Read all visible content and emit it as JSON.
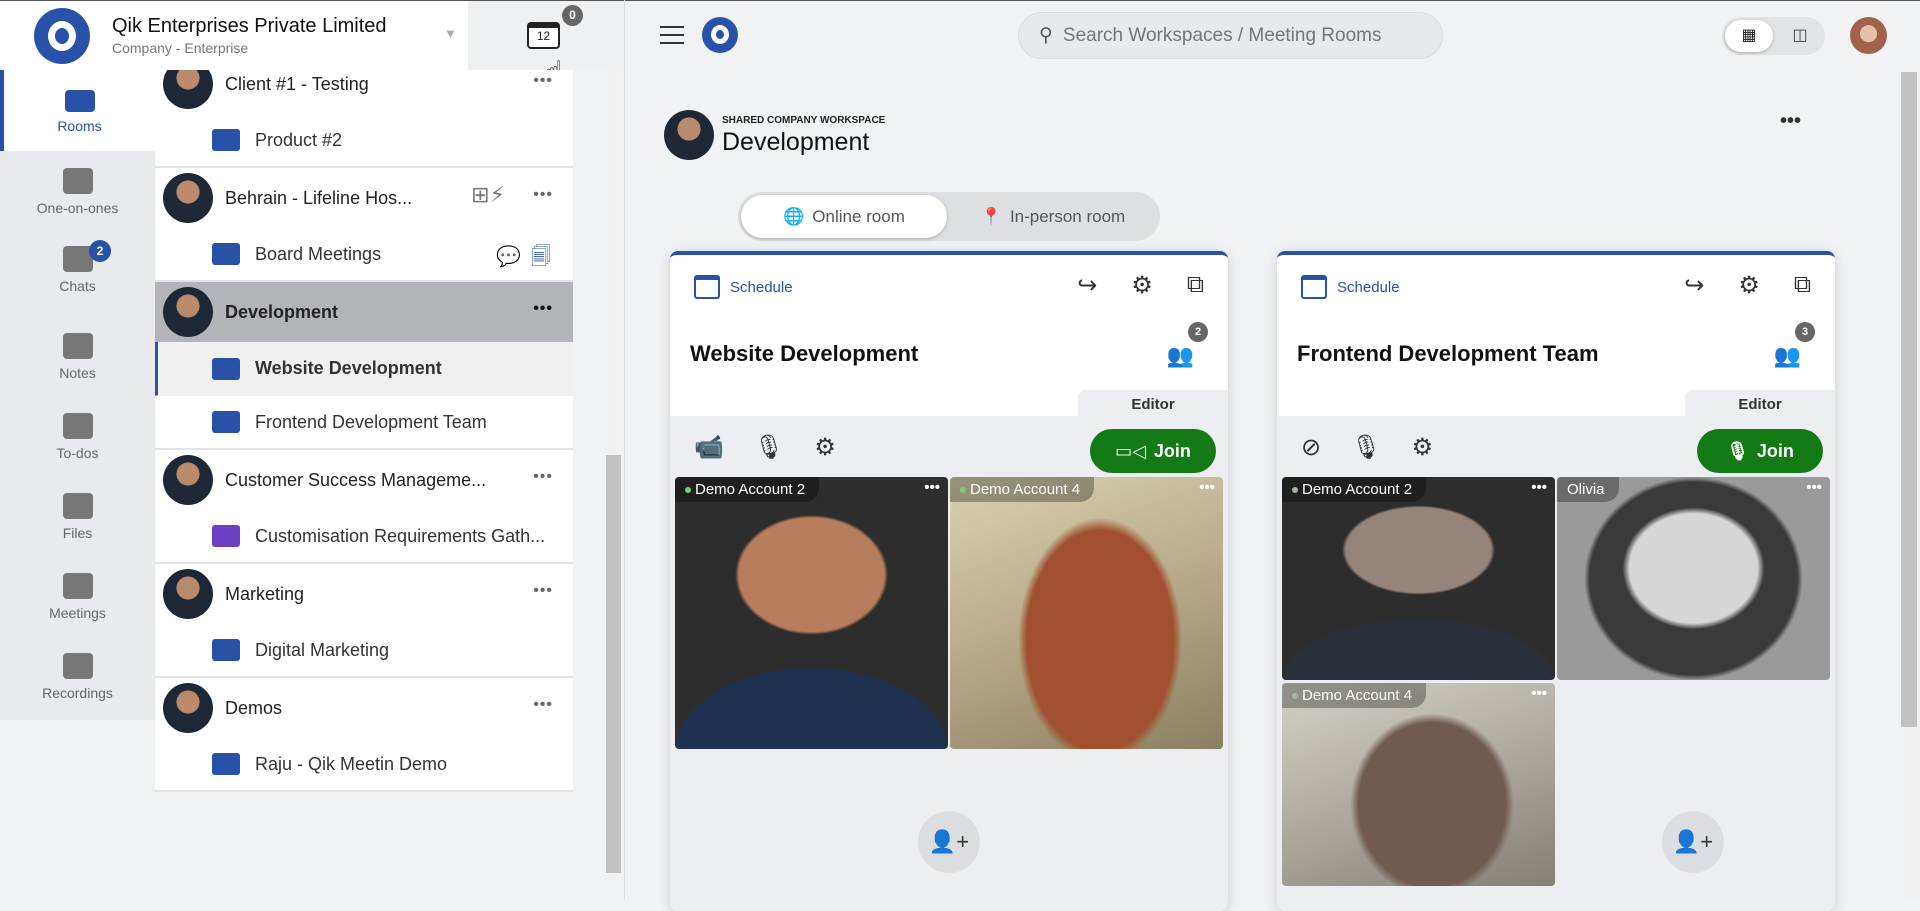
{
  "org": {
    "name": "Qik Enterprises Private Limited",
    "subtitle": "Company - Enterprise",
    "calendar_day": "12",
    "calendar_badge": "0"
  },
  "rail": [
    {
      "label": "Rooms",
      "icon": "rooms-icon",
      "active": true
    },
    {
      "label": "One-on-ones",
      "icon": "people-icon"
    },
    {
      "label": "Chats",
      "icon": "chat-icon",
      "badge": "2"
    },
    {
      "label": "Notes",
      "icon": "notes-icon"
    },
    {
      "label": "To-dos",
      "icon": "todo-icon"
    },
    {
      "label": "Files",
      "icon": "files-icon"
    },
    {
      "label": "Meetings",
      "icon": "meetings-icon"
    },
    {
      "label": "Recordings",
      "icon": "recordings-icon"
    }
  ],
  "groups": [
    {
      "name": "Client #1 - Testing",
      "rooms": [
        {
          "name": "Product #2",
          "color": "#2752a8"
        }
      ]
    },
    {
      "name": "Behrain - Lifeline Hos...",
      "quick_add": true,
      "rooms": [
        {
          "name": "Board Meetings",
          "color": "#2752a8",
          "icons": [
            "chat-icon",
            "files-icon"
          ]
        }
      ]
    },
    {
      "name": "Development",
      "selected": true,
      "rooms": [
        {
          "name": "Website Development",
          "color": "#2752a8",
          "selected": true
        },
        {
          "name": "Frontend Development Team",
          "color": "#2752a8"
        }
      ]
    },
    {
      "name": "Customer Success Manageme...",
      "rooms": [
        {
          "name": "Customisation Requirements Gath...",
          "color": "#6e3fc4"
        }
      ]
    },
    {
      "name": "Marketing",
      "rooms": [
        {
          "name": "Digital Marketing",
          "color": "#2752a8"
        }
      ]
    },
    {
      "name": "Demos",
      "rooms": [
        {
          "name": "Raju - Qik Meetin Demo",
          "color": "#2752a8"
        }
      ]
    }
  ],
  "search": {
    "placeholder": "Search Workspaces / Meeting Rooms"
  },
  "workspace": {
    "label": "SHARED COMPANY WORKSPACE",
    "title": "Development"
  },
  "tabs": {
    "online": "Online room",
    "inperson": "In-person room",
    "active": "online"
  },
  "cards": [
    {
      "schedule": "Schedule",
      "title": "Website Development",
      "participants": "2",
      "role": "Editor",
      "join": "Join",
      "camera_on": true,
      "mic_on": true,
      "tiles": [
        {
          "name": "Demo Account 2",
          "kind": "man"
        },
        {
          "name": "Demo Account 4",
          "kind": "girl"
        }
      ]
    },
    {
      "schedule": "Schedule",
      "title": "Frontend Development Team",
      "participants": "3",
      "role": "Editor",
      "join": "Join",
      "camera_on": false,
      "mic_on": false,
      "tiles": [
        {
          "name": "Demo Account 2",
          "kind": "man"
        },
        {
          "name": "Olivia",
          "kind": "olivia"
        },
        {
          "name": "Demo Account 4",
          "kind": "girl"
        }
      ]
    }
  ],
  "colors": {
    "brand": "#2752a8",
    "join": "#137a15"
  }
}
